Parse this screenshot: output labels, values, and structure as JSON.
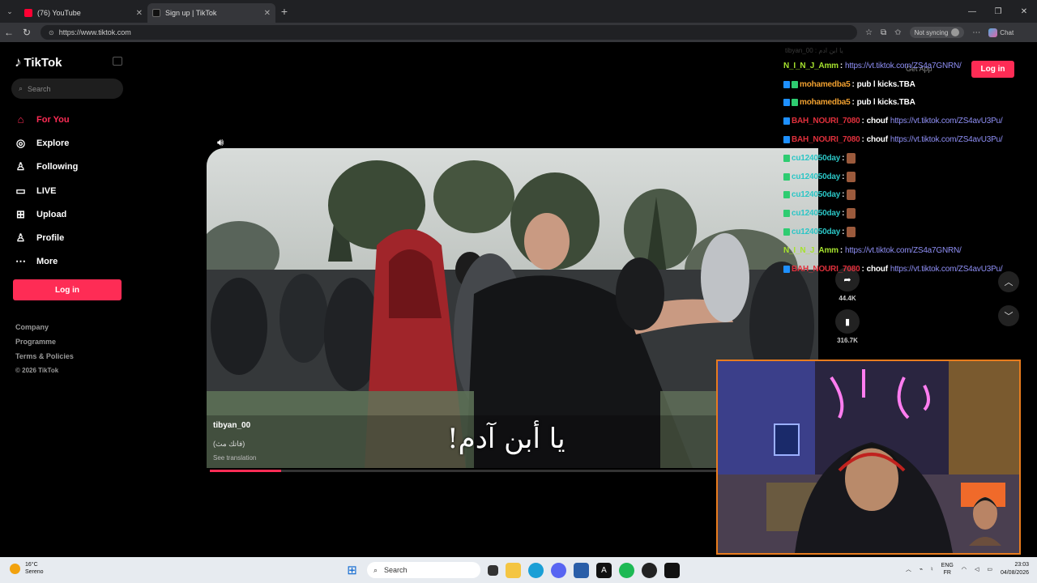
{
  "browser": {
    "tabs": [
      {
        "title": "(76) YouTube",
        "favicon_color": "#ff0033",
        "active": false
      },
      {
        "title": "Sign up | TikTok",
        "favicon_color": "#111111",
        "active": true
      }
    ],
    "new_tab_symbol": "+",
    "url": "https://www.tiktok.com",
    "sync_label": "Not syncing",
    "chat_label": "Chat"
  },
  "sidebar": {
    "logo": "TikTok",
    "search_placeholder": "Search",
    "nav": [
      {
        "label": "For You",
        "icon": "home-icon",
        "active": true
      },
      {
        "label": "Explore",
        "icon": "compass-icon",
        "active": false
      },
      {
        "label": "Following",
        "icon": "user-icon",
        "active": false
      },
      {
        "label": "LIVE",
        "icon": "live-icon",
        "active": false
      },
      {
        "label": "Upload",
        "icon": "plus-square-icon",
        "active": false
      },
      {
        "label": "Profile",
        "icon": "profile-icon",
        "active": false
      },
      {
        "label": "More",
        "icon": "more-icon",
        "active": false
      }
    ],
    "login_label": "Log in",
    "footer": [
      "Company",
      "Programme",
      "Terms & Policies",
      "© 2026 TikTok"
    ]
  },
  "header": {
    "get_app": "Get App",
    "login_label": "Log in"
  },
  "video": {
    "author": "tibyan_00",
    "caption": "(فاتك مث)",
    "translate": "See translation",
    "subtitle": "يا أبن آدم!",
    "progress": 0.14
  },
  "actions": [
    {
      "icon": "share-icon",
      "count": "44.4K"
    },
    {
      "icon": "bookmark-icon",
      "count": "316.7K"
    }
  ],
  "chat": {
    "faded_line": "tibyan_00 : يا ابن ادم",
    "lines": [
      {
        "user": "N_I_N_J_Amm",
        "user_color": "#a6e22e",
        "badges": [],
        "text": "",
        "link": "https://vt.tiktok.com/ZS4a7GNRN/"
      },
      {
        "user": "mohamedba5",
        "user_color": "#f0a030",
        "badges": [
          "#1e90ff",
          "#2ecc71"
        ],
        "text": "pub l kicks.TBA",
        "link": ""
      },
      {
        "user": "mohamedba5",
        "user_color": "#f0a030",
        "badges": [
          "#1e90ff",
          "#2ecc71"
        ],
        "text": "pub l kicks.TBA",
        "link": ""
      },
      {
        "user": "BAH_NOURI_7080",
        "user_color": "#e0303c",
        "badges": [
          "#1e90ff"
        ],
        "text": "chouf",
        "link": "https://vt.tiktok.com/ZS4avU3Pu/"
      },
      {
        "user": "BAH_NOURI_7080",
        "user_color": "#e0303c",
        "badges": [
          "#1e90ff"
        ],
        "text": "chouf",
        "link": "https://vt.tiktok.com/ZS4avU3Pu/"
      },
      {
        "user": "cu124050day",
        "user_color": "#2bc6c6",
        "badges": [
          "#2ecc71"
        ],
        "text": "",
        "link": "",
        "emote": true
      },
      {
        "user": "cu124050day",
        "user_color": "#2bc6c6",
        "badges": [
          "#2ecc71"
        ],
        "text": "",
        "link": "",
        "emote": true
      },
      {
        "user": "cu124050day",
        "user_color": "#2bc6c6",
        "badges": [
          "#2ecc71"
        ],
        "text": "",
        "link": "",
        "emote": true
      },
      {
        "user": "cu124050day",
        "user_color": "#2bc6c6",
        "badges": [
          "#2ecc71"
        ],
        "text": "",
        "link": "",
        "emote": true
      },
      {
        "user": "cu124050day",
        "user_color": "#2bc6c6",
        "badges": [
          "#2ecc71"
        ],
        "text": "",
        "link": "",
        "emote": true
      },
      {
        "user": "N_I_N_J_Amm",
        "user_color": "#a6e22e",
        "badges": [],
        "text": "",
        "link": "https://vt.tiktok.com/ZS4a7GNRN/"
      },
      {
        "user": "BAH_NOURI_7080",
        "user_color": "#e0303c",
        "badges": [
          "#1e90ff"
        ],
        "text": "chouf",
        "link": "https://vt.tiktok.com/ZS4avU3Pu/"
      }
    ]
  },
  "taskbar": {
    "temp": "16°C",
    "weather": "Sereno",
    "search_placeholder": "Search",
    "lang1": "ENG",
    "lang2": "FR",
    "time": "23:03",
    "date": "04/08/2026"
  }
}
